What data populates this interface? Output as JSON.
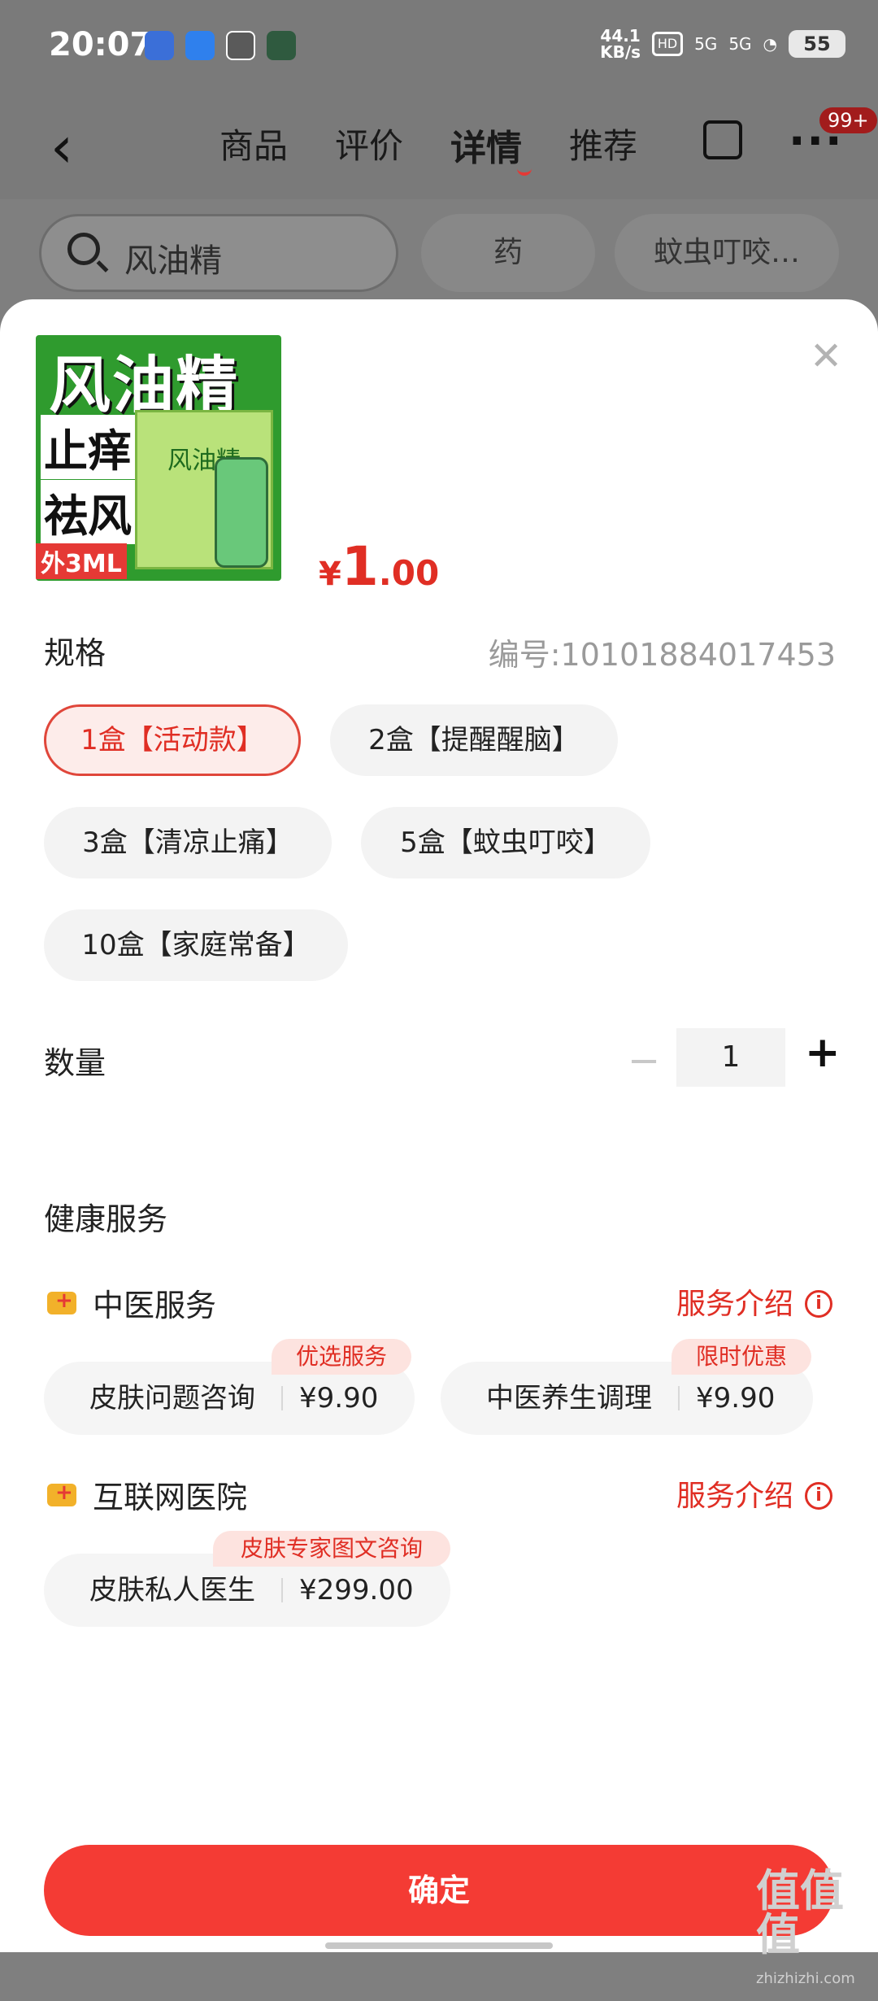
{
  "status_bar": {
    "time": "20:07",
    "speed_top": "44.1",
    "speed_bottom": "KB/s",
    "hd": "HD",
    "sig1": "5G",
    "sig2": "5G",
    "battery": "55"
  },
  "nav": {
    "back_icon": "chevron-left",
    "tabs": [
      "商品",
      "评价",
      "详情",
      "推荐"
    ],
    "active_tab": "详情",
    "badge": "99+"
  },
  "search": {
    "value": "风油精",
    "chips": [
      "药",
      "蚊虫叮咬…"
    ]
  },
  "product": {
    "image_title": "风油精",
    "image_tag1": "止痒",
    "image_tag2": "祛风",
    "image_box_text": "风油精",
    "image_volume": "外3ML",
    "price_symbol": "¥",
    "price_int": "1",
    "price_dec": ".00"
  },
  "spec": {
    "label": "规格",
    "code": "编号:10101884017453",
    "options": [
      "1盒【活动款】",
      "2盒【提醒醒脑】",
      "3盒【清凉止痛】",
      "5盒【蚊虫叮咬】",
      "10盒【家庭常备】"
    ]
  },
  "quantity": {
    "label": "数量",
    "minus": "−",
    "value": "1",
    "plus": "+"
  },
  "health": {
    "title": "健康服务",
    "groups": [
      {
        "title": "中医服务",
        "link": "服务介绍",
        "items": [
          {
            "name": "皮肤问题咨询",
            "price": "¥9.90",
            "tag": "优选服务"
          },
          {
            "name": "中医养生调理",
            "price": "¥9.90",
            "tag": "限时优惠"
          }
        ]
      },
      {
        "title": "互联网医院",
        "link": "服务介绍",
        "items": [
          {
            "name": "皮肤私人医生",
            "price": "¥299.00",
            "tag": "皮肤专家图文咨询"
          }
        ]
      }
    ]
  },
  "confirm_label": "确定",
  "watermark": {
    "big": "值值值",
    "small": "zhizhizhi.com"
  },
  "colors": {
    "accent": "#e02e24",
    "button": "#f43b34"
  }
}
